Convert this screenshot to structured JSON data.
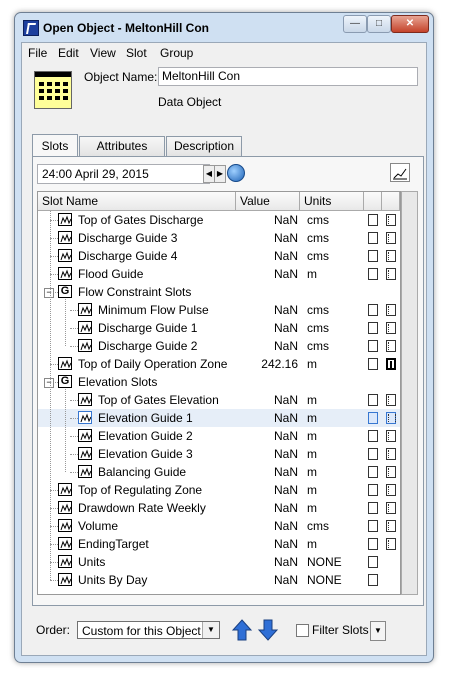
{
  "window": {
    "title": "Open Object - MeltonHill Con"
  },
  "menubar": [
    "File",
    "Edit",
    "View",
    "Slot",
    "Group"
  ],
  "object": {
    "name_label": "Object Name:",
    "name_value": "MeltonHill Con",
    "type": "Data Object",
    "icon": "data-object-grid-icon"
  },
  "tabs": [
    {
      "label": "Slots",
      "active": true
    },
    {
      "label": "Attributes",
      "active": false
    },
    {
      "label": "Description",
      "active": false
    }
  ],
  "timestep": {
    "value": "24:00 April 29, 2015"
  },
  "columns": {
    "name": "Slot Name",
    "value": "Value",
    "units": "Units"
  },
  "rows": [
    {
      "type": "slot",
      "depth": 0,
      "name": "Top of Gates Discharge",
      "value": "NaN",
      "units": "cms",
      "flag1": "empty",
      "flag2": "x"
    },
    {
      "type": "slot",
      "depth": 0,
      "name": "Discharge Guide 3",
      "value": "NaN",
      "units": "cms",
      "flag1": "empty",
      "flag2": "x"
    },
    {
      "type": "slot",
      "depth": 0,
      "name": "Discharge Guide 4",
      "value": "NaN",
      "units": "cms",
      "flag1": "empty",
      "flag2": "x"
    },
    {
      "type": "slot",
      "depth": 0,
      "name": "Flood Guide",
      "value": "NaN",
      "units": "m",
      "flag1": "empty",
      "flag2": "x"
    },
    {
      "type": "group",
      "depth": 0,
      "name": "Flow Constraint Slots",
      "value": "",
      "units": "",
      "flag1": "",
      "flag2": ""
    },
    {
      "type": "slot",
      "depth": 1,
      "name": "Minimum Flow Pulse",
      "value": "NaN",
      "units": "cms",
      "flag1": "empty",
      "flag2": "x"
    },
    {
      "type": "slot",
      "depth": 1,
      "name": "Discharge Guide 1",
      "value": "NaN",
      "units": "cms",
      "flag1": "empty",
      "flag2": "x"
    },
    {
      "type": "slot",
      "depth": 1,
      "name": "Discharge Guide 2",
      "value": "NaN",
      "units": "cms",
      "flag1": "empty",
      "flag2": "x"
    },
    {
      "type": "slot",
      "depth": 0,
      "name": "Top of Daily Operation Zone",
      "value": "242.16",
      "units": "m",
      "flag1": "empty",
      "flag2": "bold"
    },
    {
      "type": "group",
      "depth": 0,
      "name": "Elevation Slots",
      "value": "",
      "units": "",
      "flag1": "",
      "flag2": ""
    },
    {
      "type": "slot",
      "depth": 1,
      "name": "Top of Gates Elevation",
      "value": "NaN",
      "units": "m",
      "flag1": "empty",
      "flag2": "x"
    },
    {
      "type": "slot",
      "depth": 1,
      "name": "Elevation Guide 1",
      "value": "NaN",
      "units": "m",
      "flag1": "empty",
      "flag2": "x",
      "selected": true
    },
    {
      "type": "slot",
      "depth": 1,
      "name": "Elevation Guide 2",
      "value": "NaN",
      "units": "m",
      "flag1": "empty",
      "flag2": "x"
    },
    {
      "type": "slot",
      "depth": 1,
      "name": "Elevation Guide 3",
      "value": "NaN",
      "units": "m",
      "flag1": "empty",
      "flag2": "x"
    },
    {
      "type": "slot",
      "depth": 1,
      "name": "Balancing Guide",
      "value": "NaN",
      "units": "m",
      "flag1": "empty",
      "flag2": "x"
    },
    {
      "type": "slot",
      "depth": 0,
      "name": "Top of Regulating Zone",
      "value": "NaN",
      "units": "m",
      "flag1": "empty",
      "flag2": "x"
    },
    {
      "type": "slot",
      "depth": 0,
      "name": "Drawdown Rate Weekly",
      "value": "NaN",
      "units": "m",
      "flag1": "empty",
      "flag2": "x"
    },
    {
      "type": "slot",
      "depth": 0,
      "name": "Volume",
      "value": "NaN",
      "units": "cms",
      "flag1": "empty",
      "flag2": "x"
    },
    {
      "type": "slot",
      "depth": 0,
      "name": "EndingTarget",
      "value": "NaN",
      "units": "m",
      "flag1": "empty",
      "flag2": "x"
    },
    {
      "type": "slot",
      "depth": 0,
      "name": "Units",
      "value": "NaN",
      "units": "NONE",
      "flag1": "empty",
      "flag2": ""
    },
    {
      "type": "slot",
      "depth": 0,
      "name": "Units By Day",
      "value": "NaN",
      "units": "NONE",
      "flag1": "empty",
      "flag2": ""
    }
  ],
  "bottom": {
    "order_label": "Order:",
    "order_value": "Custom for this Object",
    "filter_label": "Filter Slots",
    "filter_checked": false
  },
  "colors": {
    "window_frame": "#cfe0f2",
    "selected_row": "#e6eef8",
    "arrow_blue": "#2f6fd6"
  }
}
